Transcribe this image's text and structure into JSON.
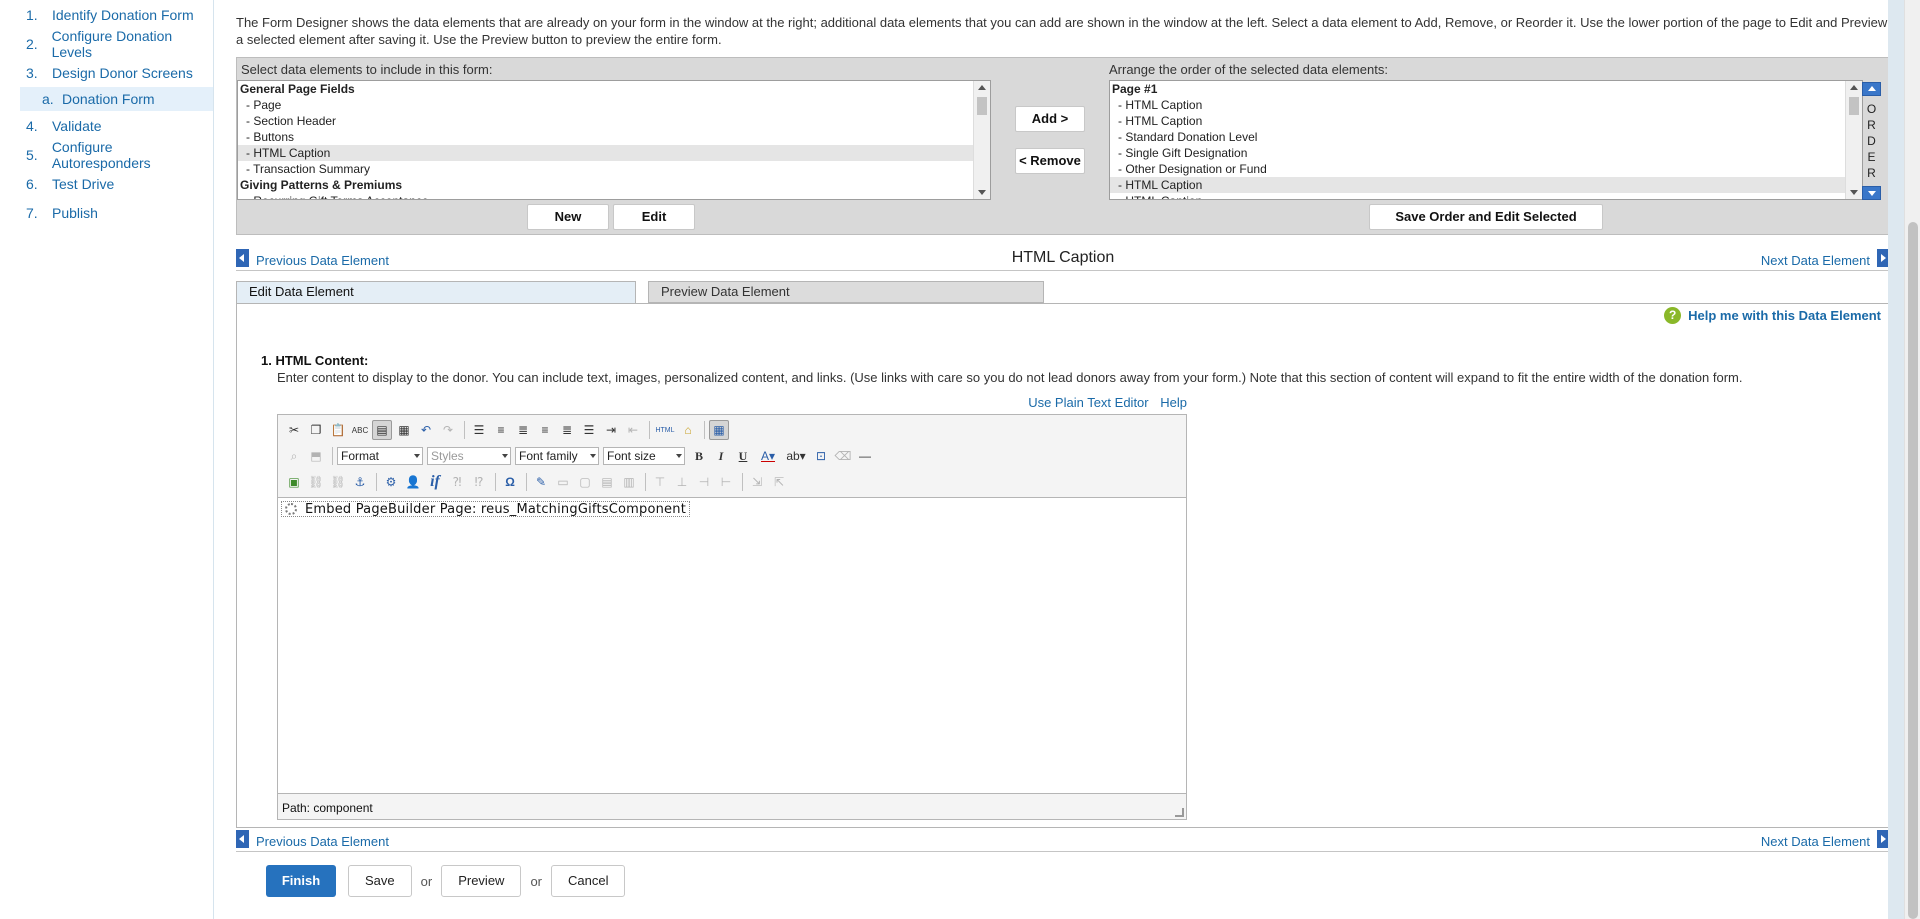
{
  "sidebar": {
    "steps": [
      {
        "num": "1.",
        "label": "Identify Donation Form"
      },
      {
        "num": "2.",
        "label": "Configure Donation Levels"
      },
      {
        "num": "3.",
        "label": "Design Donor Screens"
      },
      {
        "num": "a.",
        "label": "Donation Form"
      },
      {
        "num": "4.",
        "label": "Validate"
      },
      {
        "num": "5.",
        "label": "Configure Autoresponders"
      },
      {
        "num": "6.",
        "label": "Test Drive"
      },
      {
        "num": "7.",
        "label": "Publish"
      }
    ]
  },
  "intro": "The Form Designer shows the data elements that are already on your form in the window at the right; additional data elements that you can add are shown in the window at the left. Select a data element to Add, Remove, or Reorder it. Use the lower portion of the page to Edit and Preview a selected element after saving it. Use the Preview button to preview the entire form.",
  "designer": {
    "left_label": "Select data elements to include in this form:",
    "right_label": "Arrange the order of the selected data elements:",
    "available": [
      {
        "label": "General Page Fields",
        "group": true
      },
      {
        "label": "- Page"
      },
      {
        "label": "- Section Header"
      },
      {
        "label": "- Buttons"
      },
      {
        "label": "- HTML Caption",
        "selected": true
      },
      {
        "label": "- Transaction Summary"
      },
      {
        "label": "Giving Patterns & Premiums",
        "group": true
      },
      {
        "label": "- Recurring Gift Terms Acceptance"
      }
    ],
    "selected_elements": [
      {
        "label": "Page #1",
        "group": true
      },
      {
        "label": "- HTML Caption"
      },
      {
        "label": "- HTML Caption"
      },
      {
        "label": "- Standard Donation Level"
      },
      {
        "label": "- Single Gift Designation"
      },
      {
        "label": "- Other Designation or Fund"
      },
      {
        "label": "- HTML Caption",
        "selected": true
      },
      {
        "label": "- HTML Caption"
      }
    ],
    "add_label": "Add >",
    "remove_label": "< Remove",
    "new_label": "New",
    "edit_label": "Edit",
    "save_order_label": "Save Order and Edit Selected",
    "order_letters": "O\nR\nD\nE\nR"
  },
  "nav": {
    "prev_label": "Previous Data Element",
    "next_label": "Next Data Element",
    "title": "HTML Caption"
  },
  "tabs": {
    "edit_label": "Edit Data Element",
    "preview_label": "Preview Data Element"
  },
  "panel": {
    "help_label": "Help me with this Data Element",
    "question_title": "1. HTML Content:",
    "question_desc": "Enter content to display to the donor. You can include text, images, personalized content, and links. (Use links with care so you do not lead donors away from your form.) Note that this section of content will expand to fit the entire width of the donation form.",
    "plain_text_label": "Use Plain Text Editor",
    "editor_help_label": "Help"
  },
  "editor": {
    "format_label": "Format",
    "styles_label": "Styles",
    "font_family_label": "Font family",
    "font_size_label": "Font size",
    "content": "Embed PageBuilder Page: reus_MatchingGiftsComponent",
    "path": "Path: component",
    "html_label": "HTML",
    "bold": "B",
    "italic": "I",
    "underline": "U",
    "if_label": "if",
    "omega": "Ω"
  },
  "footer": {
    "finish_label": "Finish",
    "save_label": "Save",
    "or1": "or",
    "preview_label": "Preview",
    "or2": "or",
    "cancel_label": "Cancel"
  }
}
